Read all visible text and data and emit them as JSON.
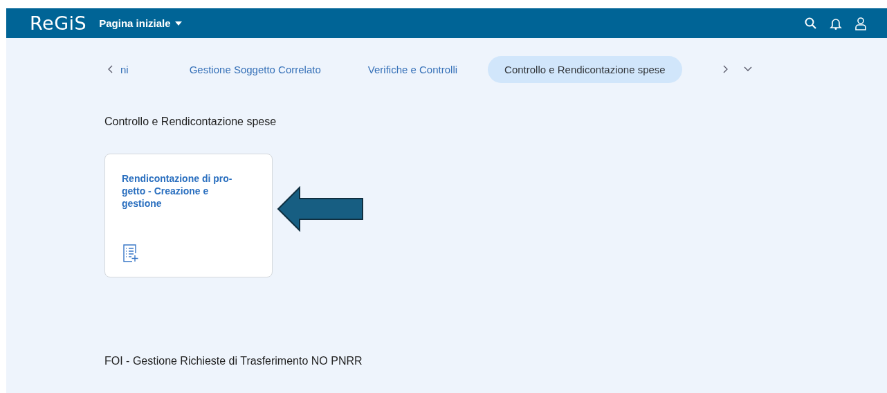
{
  "shell": {
    "logo": "ReGiS",
    "menu_title": "Pagina iniziale"
  },
  "tabs": [
    {
      "label": "ni",
      "selected": false
    },
    {
      "label": "Gestione Soggetto Correlato",
      "selected": false
    },
    {
      "label": "Verifiche e Controlli",
      "selected": false
    },
    {
      "label": "Controllo e Rendicontazione spese",
      "selected": true
    }
  ],
  "sections": [
    {
      "title": "Controllo e Rendicontazione spese",
      "tiles": [
        {
          "title": "Rendicontazione di pro-\ngetto - Creazione e\ngestione"
        }
      ]
    },
    {
      "title": "FOI - Gestione Richieste di Trasferimento NO PNRR"
    }
  ]
}
